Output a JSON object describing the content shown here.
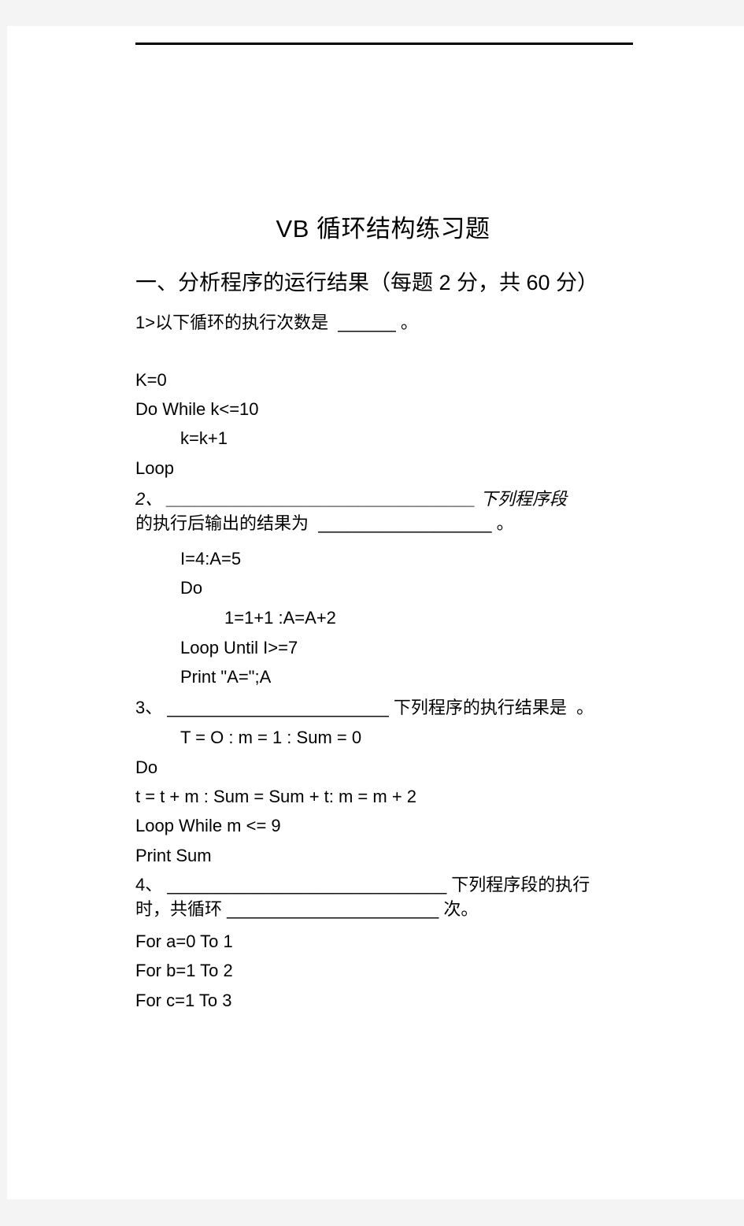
{
  "document": {
    "title": "VB 循环结构练习题",
    "section_heading": "一、分析程序的运行结果（每题 2 分，共 60 分）",
    "questions": [
      {
        "prompt": "1>以下循环的执行次数是  ______ 。",
        "code": [
          "K=0",
          "Do While k<=10",
          "k=k+1",
          "Loop"
        ]
      },
      {
        "prompt_line1": "2、 ________________________________ 下列程序段",
        "prompt_line2": "的执行后输出的结果为  __________________ 。",
        "code": [
          "I=4:A=5",
          "Do",
          "1=1+1 :A=A+2",
          "Loop Until I>=7",
          "Print \"A=\";A"
        ]
      },
      {
        "prompt": "3、 _______________________ 下列程序的执行结果是  。",
        "code": [
          "T = O : m = 1 : Sum = 0",
          "Do",
          "t = t + m : Sum = Sum + t: m = m + 2",
          "Loop While m <= 9",
          "Print Sum"
        ]
      },
      {
        "prompt_line1": "4、 _____________________________ 下列程序段的执行",
        "prompt_line2": "时，共循环 ______________________ 次。",
        "code": [
          "For a=0 To 1",
          "For b=1 To 2",
          "For c=1 To 3"
        ]
      }
    ]
  }
}
